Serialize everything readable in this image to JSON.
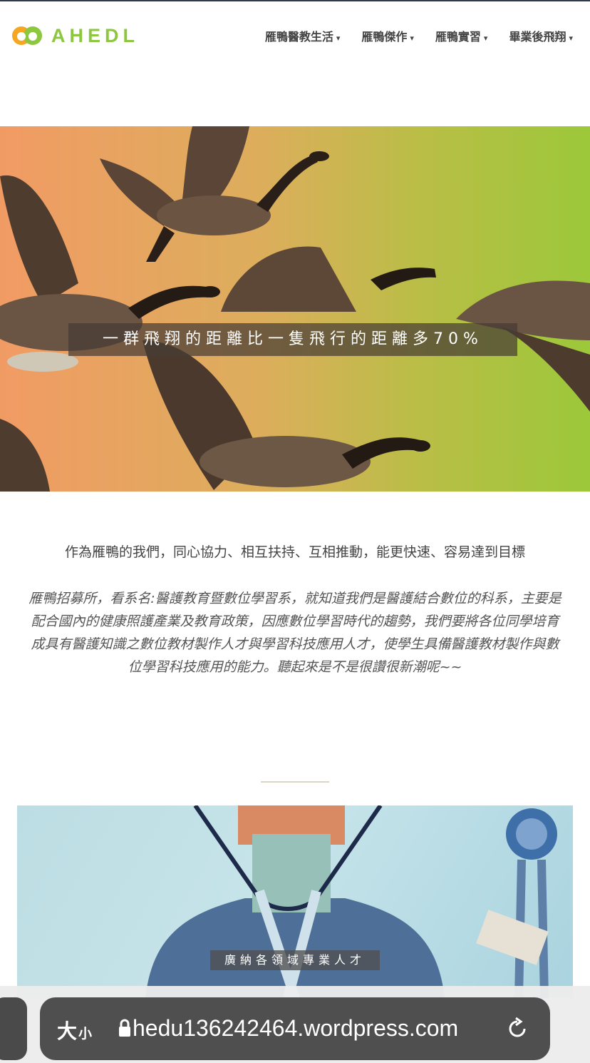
{
  "brand": {
    "name": "AHEDL",
    "colors": {
      "orange": "#f5a623",
      "green": "#8dc63f"
    }
  },
  "nav": {
    "items": [
      {
        "label": "雁鴨醫教生活"
      },
      {
        "label": "雁鴨傑作"
      },
      {
        "label": "雁鴨實習"
      },
      {
        "label": "畢業後飛翔"
      }
    ],
    "caret": "▾"
  },
  "hero": {
    "caption": "一群飛翔的距離比一隻飛行的距離多70%"
  },
  "content": {
    "lead": "作為雁鴨的我們，同心協力、相互扶持、互相推動，能更快速、容易達到目標",
    "body": "雁鴨招募所，看系名:醫護教育暨數位學習系，就知道我們是醫護結合數位的科系，主要是配合國內的健康照護產業及教育政策，因應數位學習時代的趨勢，我們要將各位同學培育成具有醫護知識之數位教材製作人才與學習科技應用人才，使學生具備醫護教材製作與數位學習科技應用的能力。聽起來是不是很讚很新潮呢~~"
  },
  "feature": {
    "caption": "廣納各領域專業人才"
  },
  "browser": {
    "text_size_large": "大",
    "text_size_small": "小",
    "url": "hedu136242464.wordpress.com",
    "icons": [
      "lock-icon",
      "reload-icon"
    ]
  }
}
